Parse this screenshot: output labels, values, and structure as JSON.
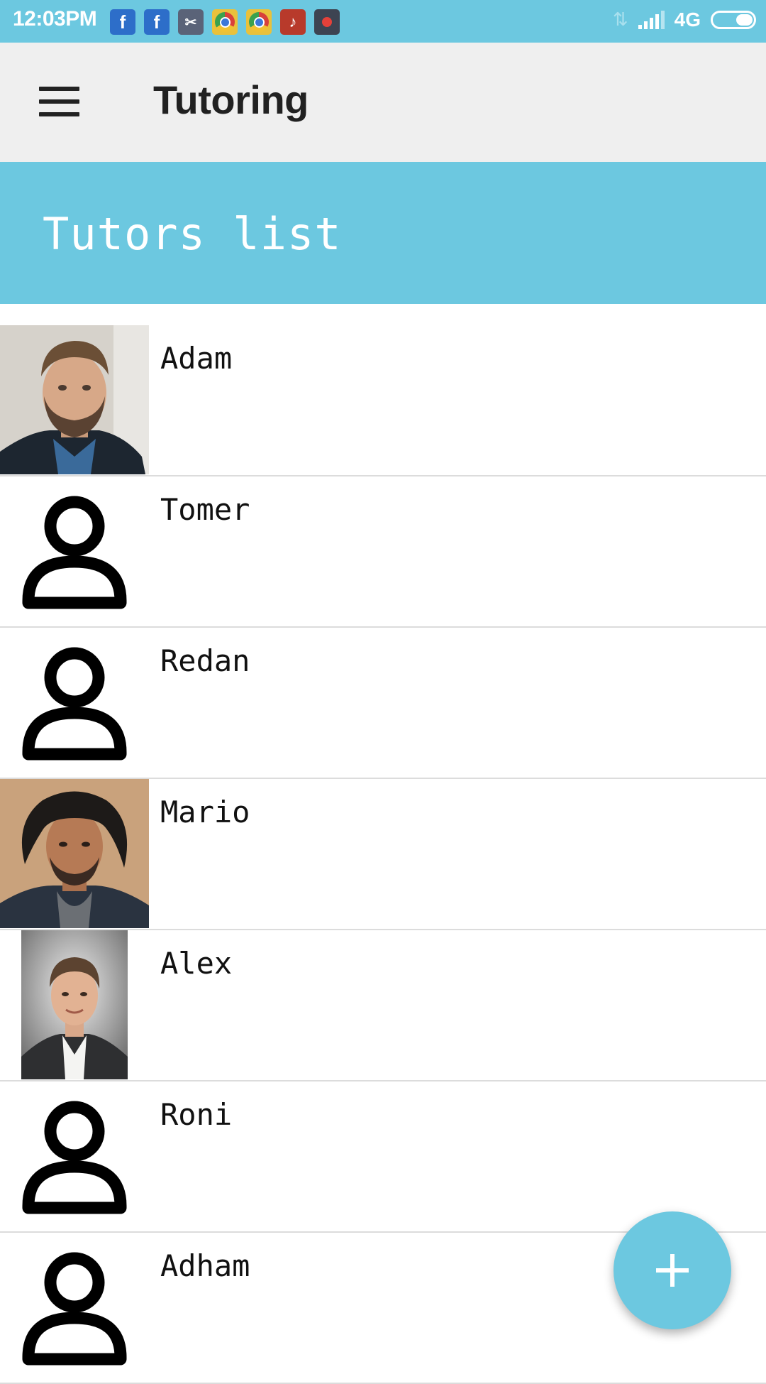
{
  "status_bar": {
    "time": "12:03PM",
    "notification_icons": [
      "facebook-icon",
      "facebook-icon",
      "screenshot-cut-icon",
      "chrome-icon",
      "chrome-icon",
      "tiktok-icon",
      "screen-record-icon"
    ],
    "network": "4G",
    "battery_level": 0.4
  },
  "app_bar": {
    "title": "Tutoring",
    "menu_icon": "hamburger-menu-icon"
  },
  "banner": {
    "title": "Tutors list"
  },
  "tutors": [
    {
      "name": "Adam",
      "photo": "portrait-photo"
    },
    {
      "name": "Tomer",
      "photo": "default-person-icon"
    },
    {
      "name": "Redan",
      "photo": "default-person-icon"
    },
    {
      "name": "Mario",
      "photo": "portrait-photo"
    },
    {
      "name": "Alex",
      "photo": "portrait-photo"
    },
    {
      "name": "Roni",
      "photo": "default-person-icon"
    },
    {
      "name": "Adham",
      "photo": "default-person-icon"
    }
  ],
  "fab": {
    "icon": "plus-icon"
  },
  "colors": {
    "accent": "#6cc8e0",
    "app_bar_bg": "#efefef",
    "divider": "#dcdcdc"
  }
}
